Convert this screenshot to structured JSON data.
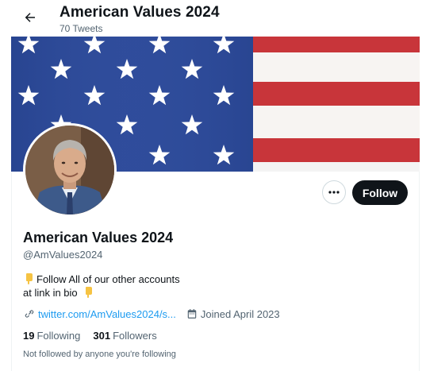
{
  "header": {
    "title": "American Values 2024",
    "tweet_count": "70 Tweets"
  },
  "profile": {
    "name": "American Values 2024",
    "handle": "@AmValues2024",
    "bio_line1": "Follow All of our other accounts",
    "bio_line2": "at link in bio",
    "link_text": "twitter.com/AmValues2024/s...",
    "joined": "Joined April 2023",
    "following_count": "19",
    "following_label": "Following",
    "followers_count": "301",
    "followers_label": "Followers",
    "not_followed_text": "Not followed by anyone you're following"
  },
  "actions": {
    "follow_label": "Follow"
  },
  "icons": {
    "back": "arrow-left-icon",
    "more": "more-dots-icon",
    "link": "link-icon",
    "calendar": "calendar-icon",
    "emoji": "pointing-down-emoji"
  },
  "colors": {
    "accent": "#1d9bf0",
    "follow_bg": "#0f1419",
    "muted": "#536471",
    "flag_blue": "#2e4b9a",
    "flag_red": "#c8353a"
  }
}
